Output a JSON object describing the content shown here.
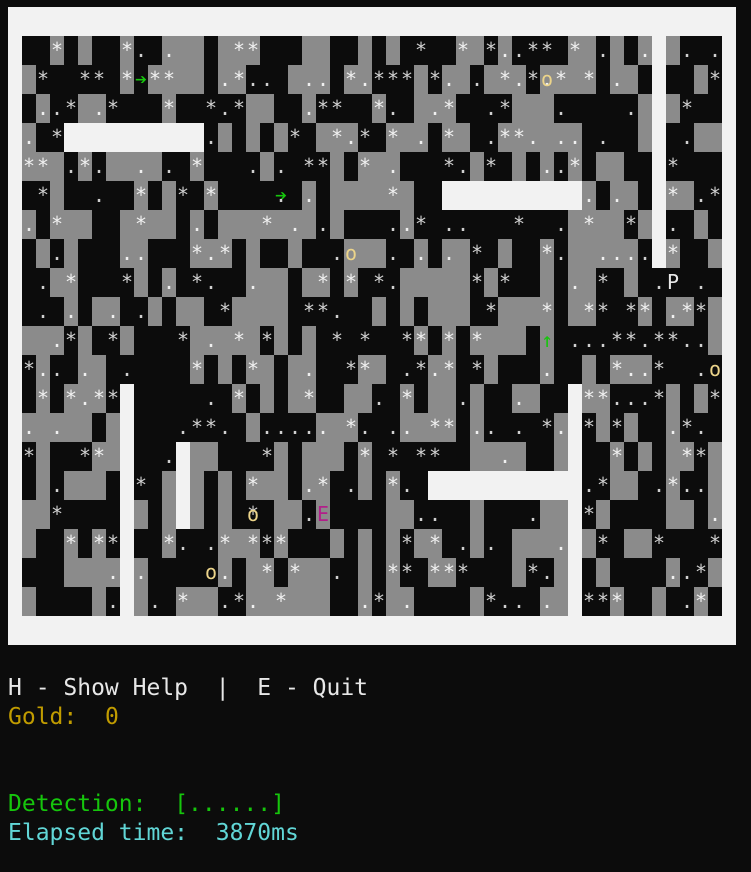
{
  "glyphs": {
    "player": "P",
    "enemy": "E",
    "gold": "o",
    "arrow_right": "➔",
    "arrow_up": "↑"
  },
  "status": {
    "help_line": "H - Show Help  |  E - Quit",
    "gold_label": "Gold:",
    "gold_value": "0",
    "detection_label": "Detection:",
    "detection_value": "[......]",
    "elapsed_label": "Elapsed time:",
    "elapsed_value": "3870ms"
  },
  "colors": {
    "background": "#0c0c0c",
    "wall": "#f2f2f2",
    "lit_floor": "#8b8b8b",
    "noise": "#d0d0d0",
    "player": "#e8e8e8",
    "enemy": "#b21f8a",
    "gold": "#ecd48a",
    "arrow": "#16c60c",
    "help_text": "#e8e8e8",
    "gold_text": "#c19c00",
    "detection_text": "#16c60c",
    "elapsed_text": "#61d6d6"
  }
}
